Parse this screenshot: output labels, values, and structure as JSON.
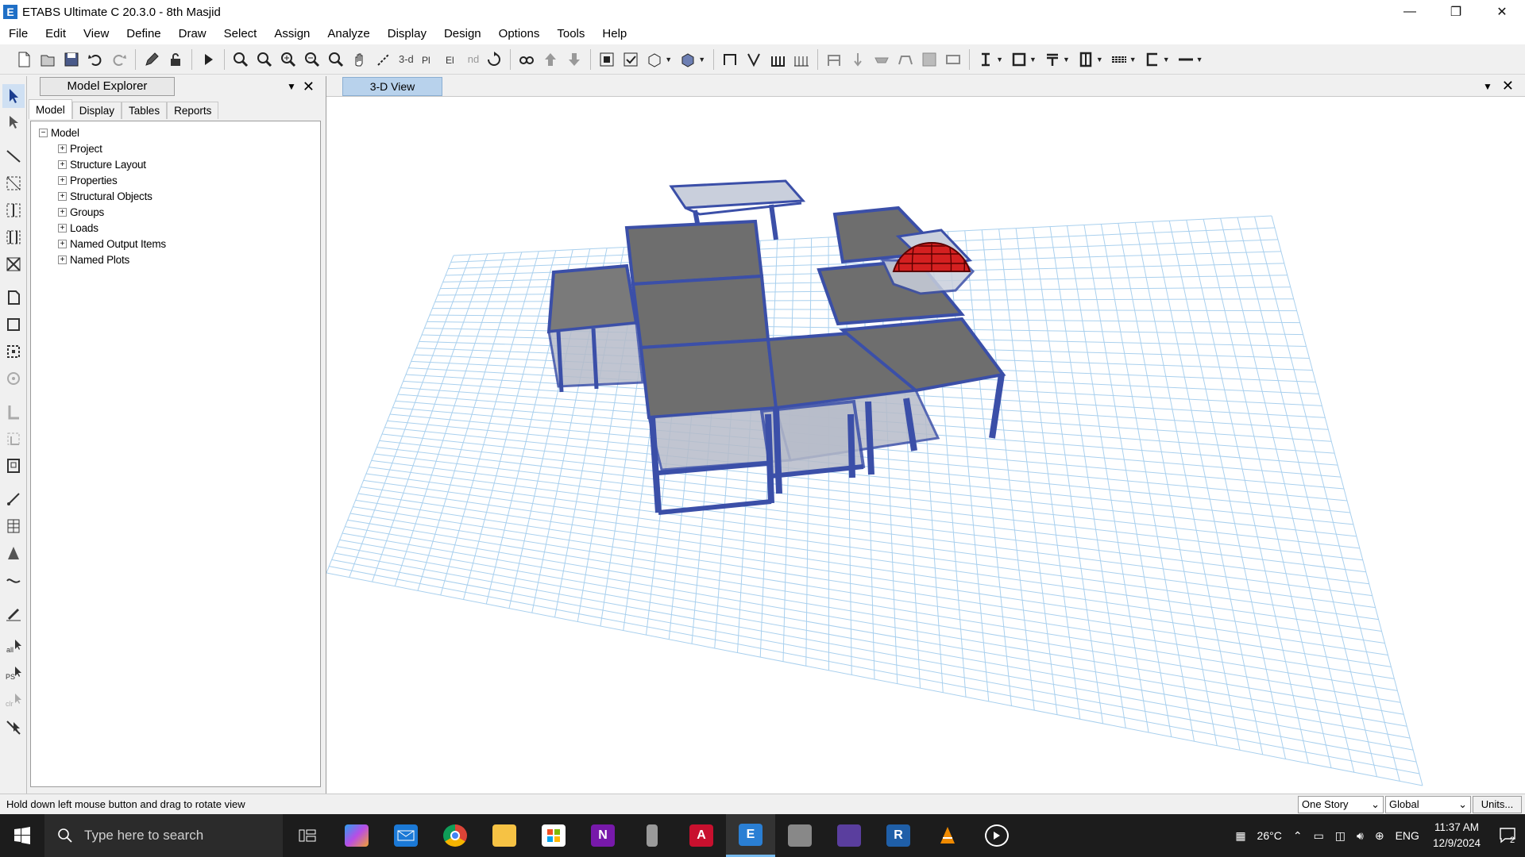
{
  "window": {
    "title": "ETABS Ultimate C 20.3.0 - 8th Masjid",
    "icon_letter": "E",
    "minimize": "—",
    "maximize": "❐",
    "close": "✕"
  },
  "menu": [
    "File",
    "Edit",
    "View",
    "Define",
    "Draw",
    "Select",
    "Assign",
    "Analyze",
    "Display",
    "Design",
    "Options",
    "Tools",
    "Help"
  ],
  "toolbar": {
    "view_3d": "3-d",
    "plan": "Plan",
    "elev": "Elev",
    "nd": "nd"
  },
  "explorer": {
    "title": "Model Explorer",
    "pin": "▼",
    "close": "✕",
    "tabs": [
      "Model",
      "Display",
      "Tables",
      "Reports"
    ],
    "active_tab": "Model",
    "root": "Model",
    "items": [
      "Project",
      "Structure Layout",
      "Properties",
      "Structural Objects",
      "Groups",
      "Loads",
      "Named Output Items",
      "Named Plots"
    ]
  },
  "view": {
    "tab": "3-D View",
    "pin": "▼",
    "close": "✕",
    "colors": {
      "grid": "#a9d0ee",
      "frame": "#3b4fa8",
      "dome": "#d42020",
      "slab": "#6e6e6e"
    }
  },
  "status": {
    "message": "Hold down left mouse button and drag to rotate view",
    "story": "One Story",
    "coord": "Global",
    "units": "Units..."
  },
  "taskbar": {
    "search_placeholder": "Type here to search",
    "weather": "26°C",
    "lang": "ENG",
    "time": "11:37 AM",
    "date": "12/9/2024",
    "notifications": "2"
  }
}
